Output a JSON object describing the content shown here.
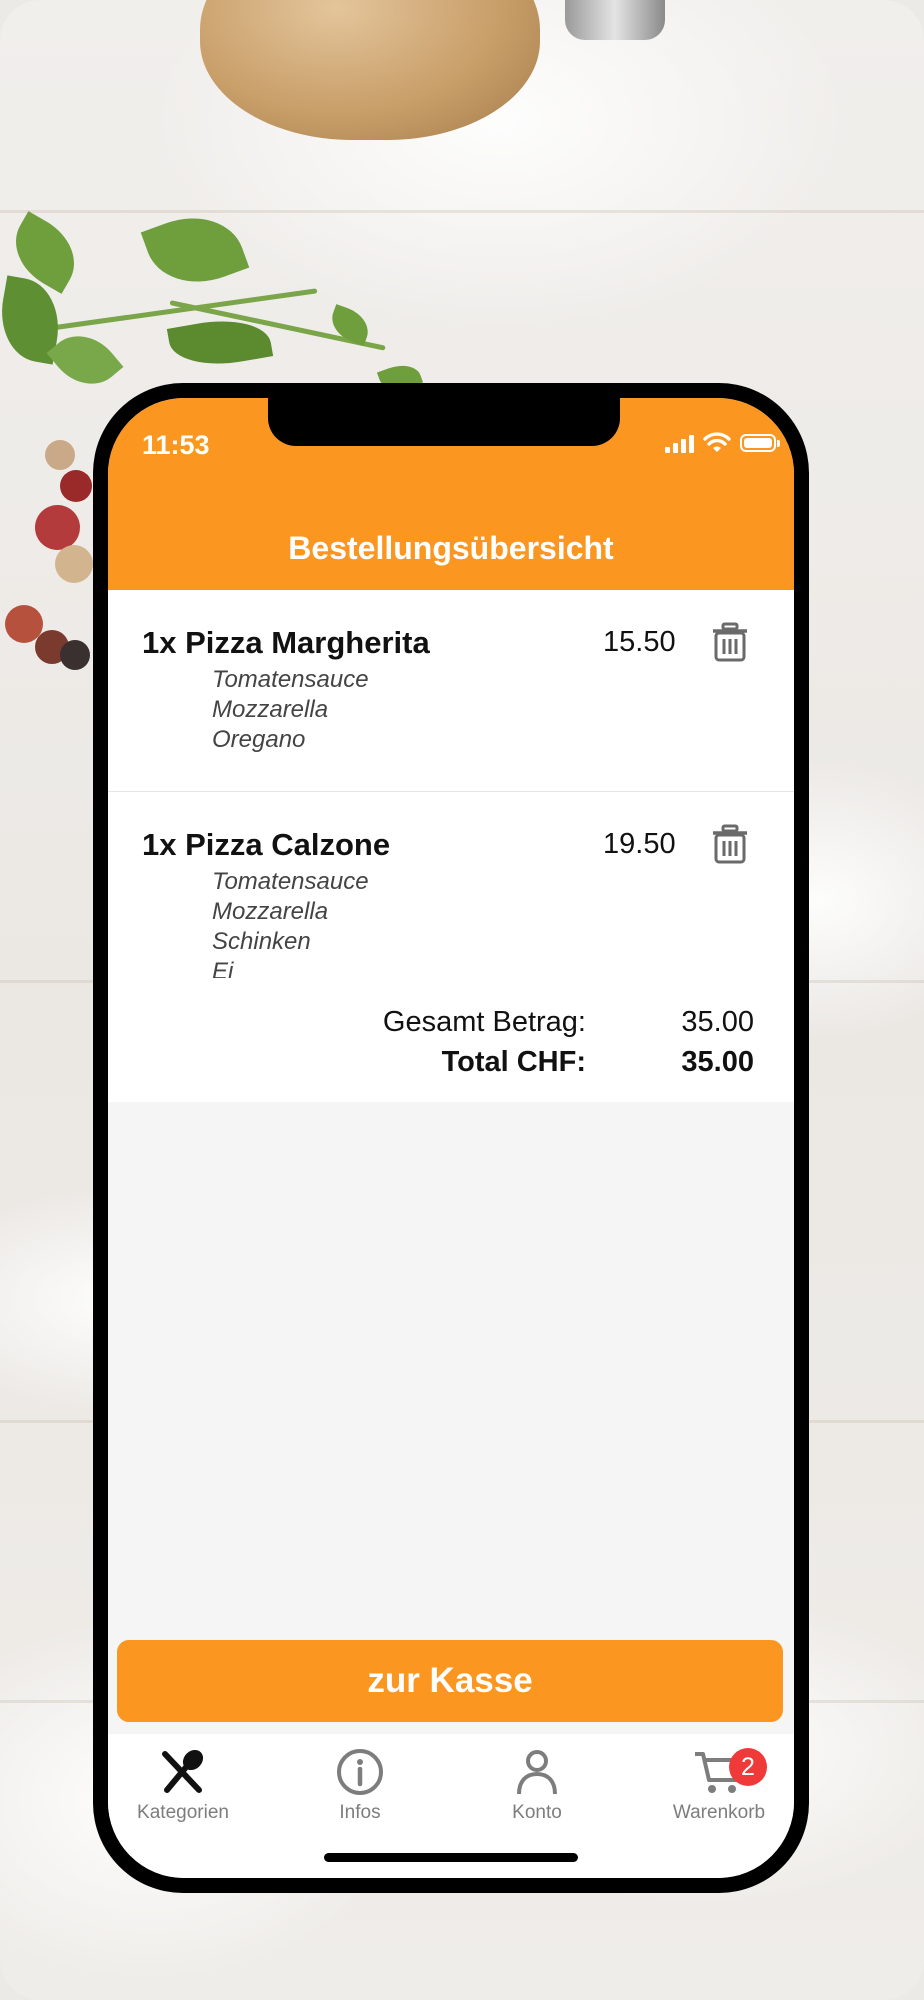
{
  "status_bar": {
    "time": "11:53"
  },
  "header": {
    "title": "Bestellungsübersicht"
  },
  "order_items": [
    {
      "quantity_name": "1x Pizza Margherita",
      "price": "15.50",
      "ingredients": [
        "Tomatensauce",
        "Mozzarella",
        "Oregano"
      ]
    },
    {
      "quantity_name": "1x Pizza Calzone",
      "price": "19.50",
      "ingredients": [
        "Tomatensauce",
        "Mozzarella",
        "Schinken",
        "Ei"
      ]
    }
  ],
  "totals": {
    "subtotal_label": "Gesamt Betrag:",
    "subtotal_value": "35.00",
    "total_label": "Total CHF:",
    "total_value": "35.00"
  },
  "checkout_button": {
    "label": "zur Kasse"
  },
  "tab_bar": {
    "items": [
      {
        "label": "Kategorien",
        "icon": "fork-spoon-icon",
        "active": true
      },
      {
        "label": "Infos",
        "icon": "info-icon"
      },
      {
        "label": "Konto",
        "icon": "person-icon"
      },
      {
        "label": "Warenkorb",
        "icon": "cart-icon",
        "badge": "2"
      }
    ]
  },
  "colors": {
    "accent": "#fb9720",
    "badge": "#f03a3a",
    "inactive_tab": "#7d7d7d"
  }
}
